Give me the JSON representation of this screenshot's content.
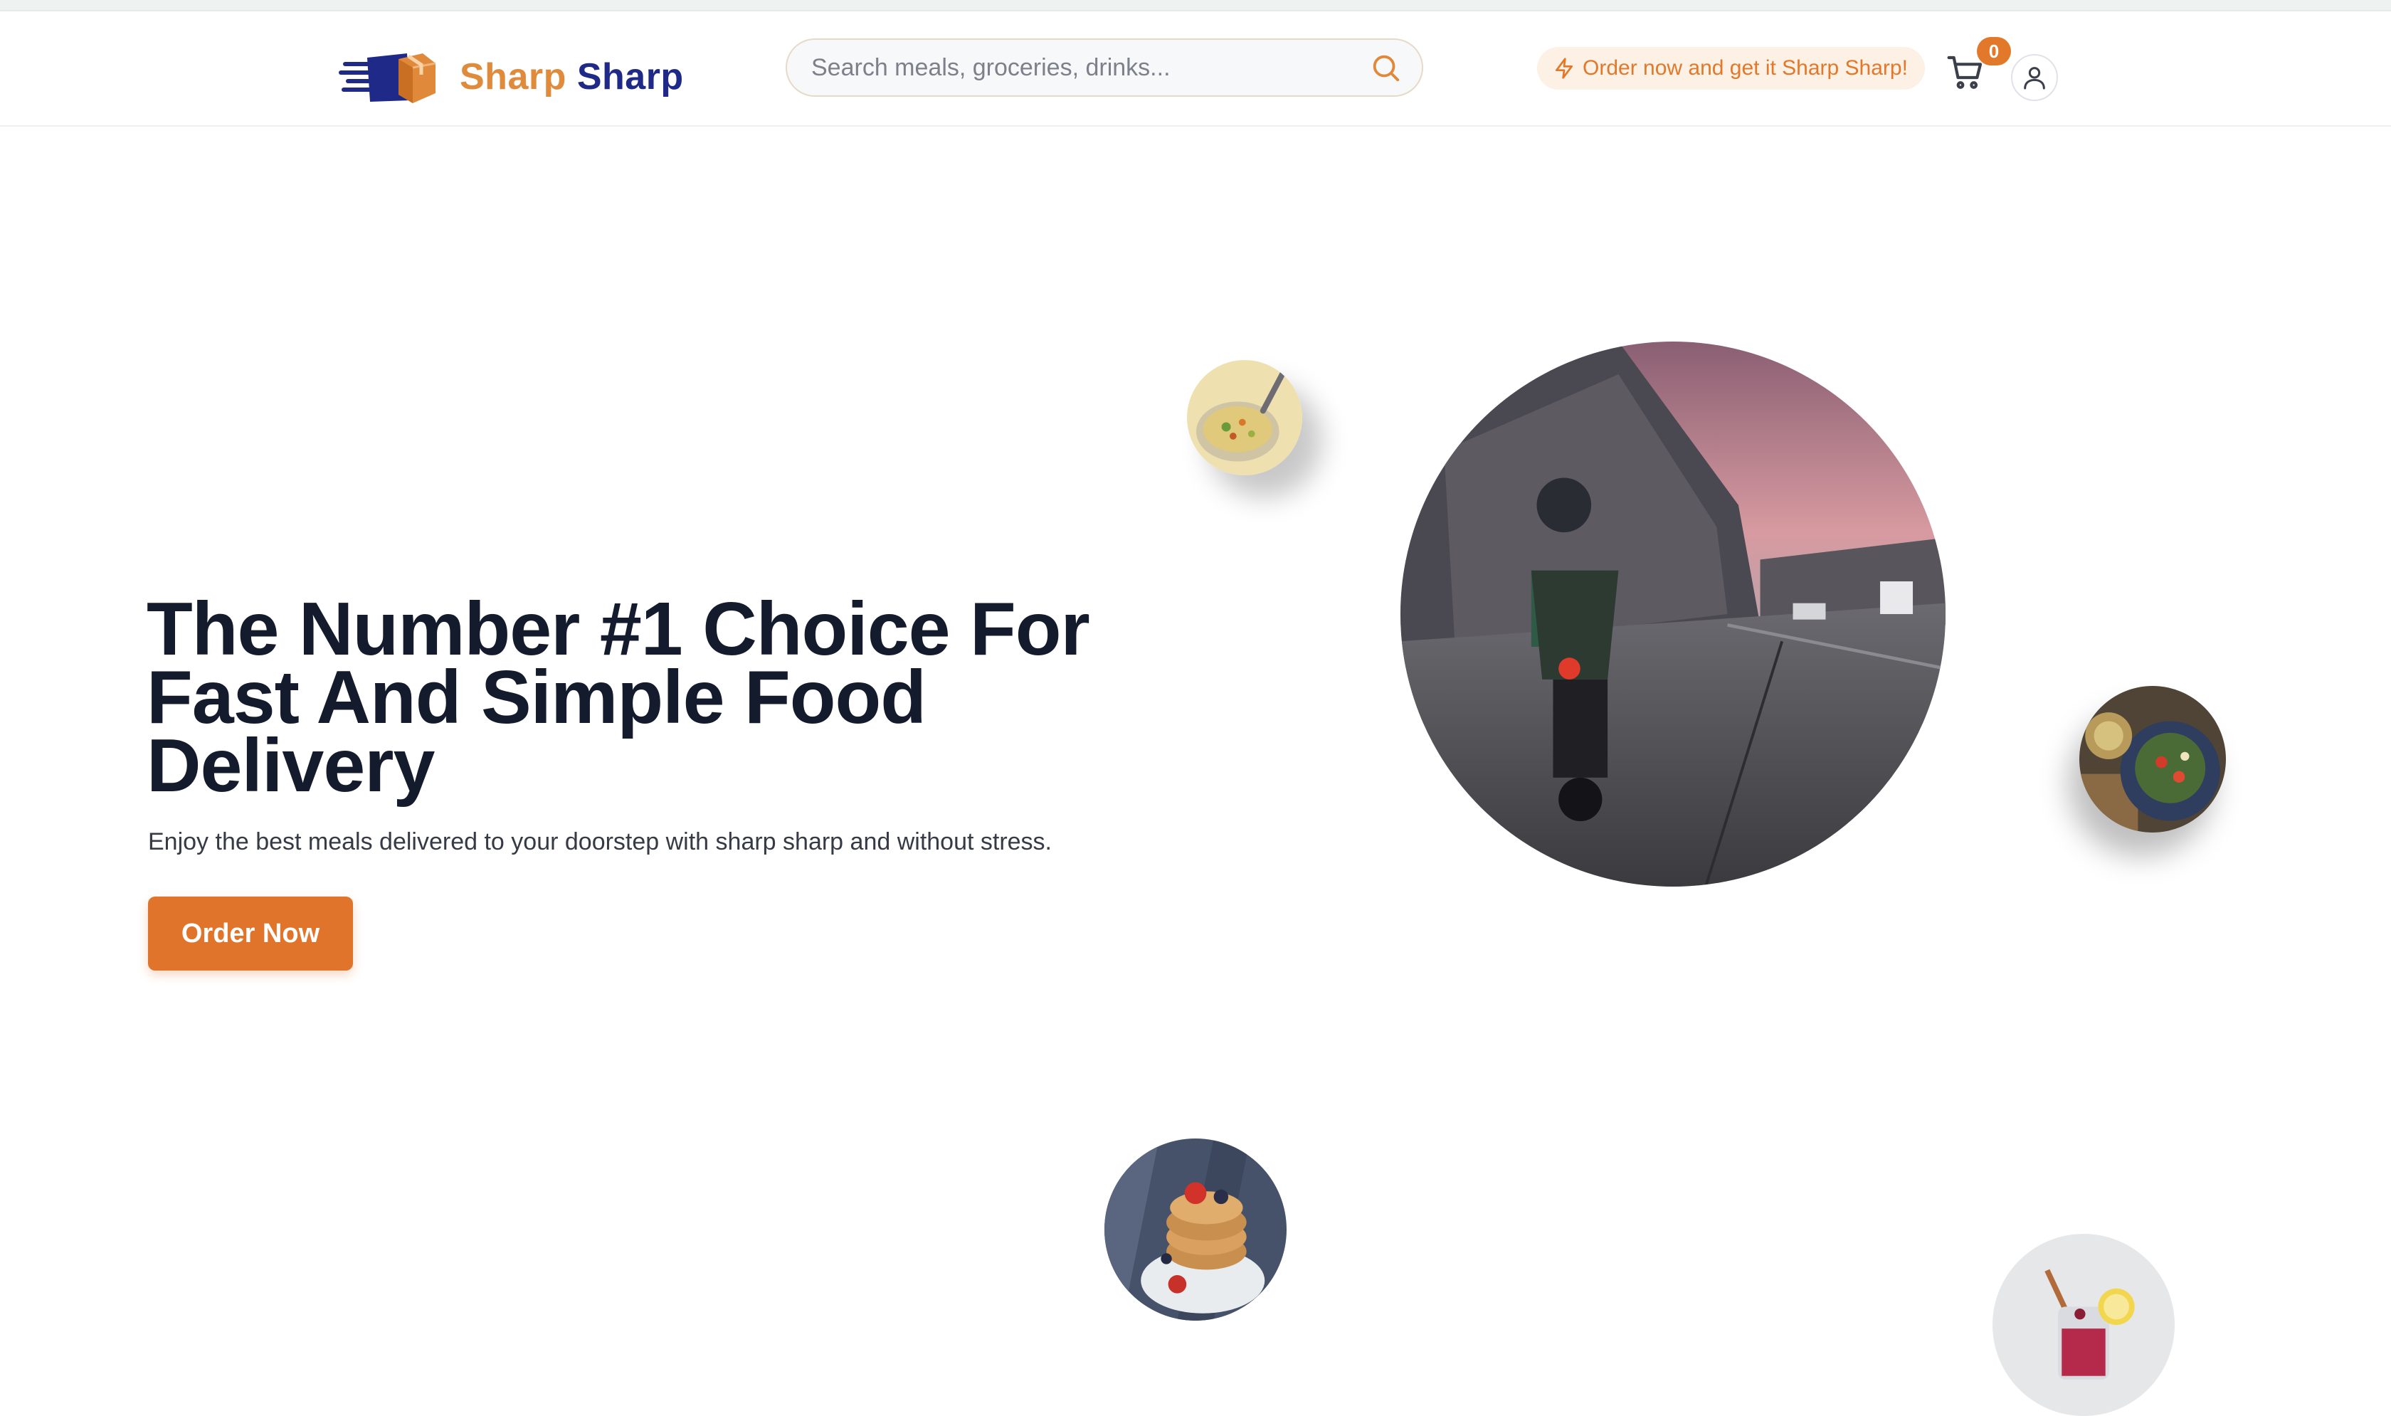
{
  "header": {
    "logo_text_1": "Sharp",
    "logo_text_2": "Sharp",
    "search_placeholder": "Search meals, groceries, drinks...",
    "promo_text": "Order now and get it Sharp Sharp!",
    "cart_count": "0"
  },
  "hero": {
    "title": "The Number #1 Choice For Fast And Simple Food Delivery",
    "subtitle": "Enjoy the best meals delivered to your doorstep with sharp sharp and without stress.",
    "cta_label": "Order Now"
  },
  "colors": {
    "accent": "#e0742a",
    "brand_blue": "#1f2a88",
    "brand_orange": "#e08a3c",
    "heading": "#141b2d"
  },
  "icons": [
    "logo-icon",
    "search-icon",
    "lightning-icon",
    "cart-icon",
    "user-icon"
  ],
  "images": [
    "delivery-rider-image",
    "soup-ladle-image",
    "salad-bowl-image",
    "pancake-image",
    "drink-image"
  ]
}
